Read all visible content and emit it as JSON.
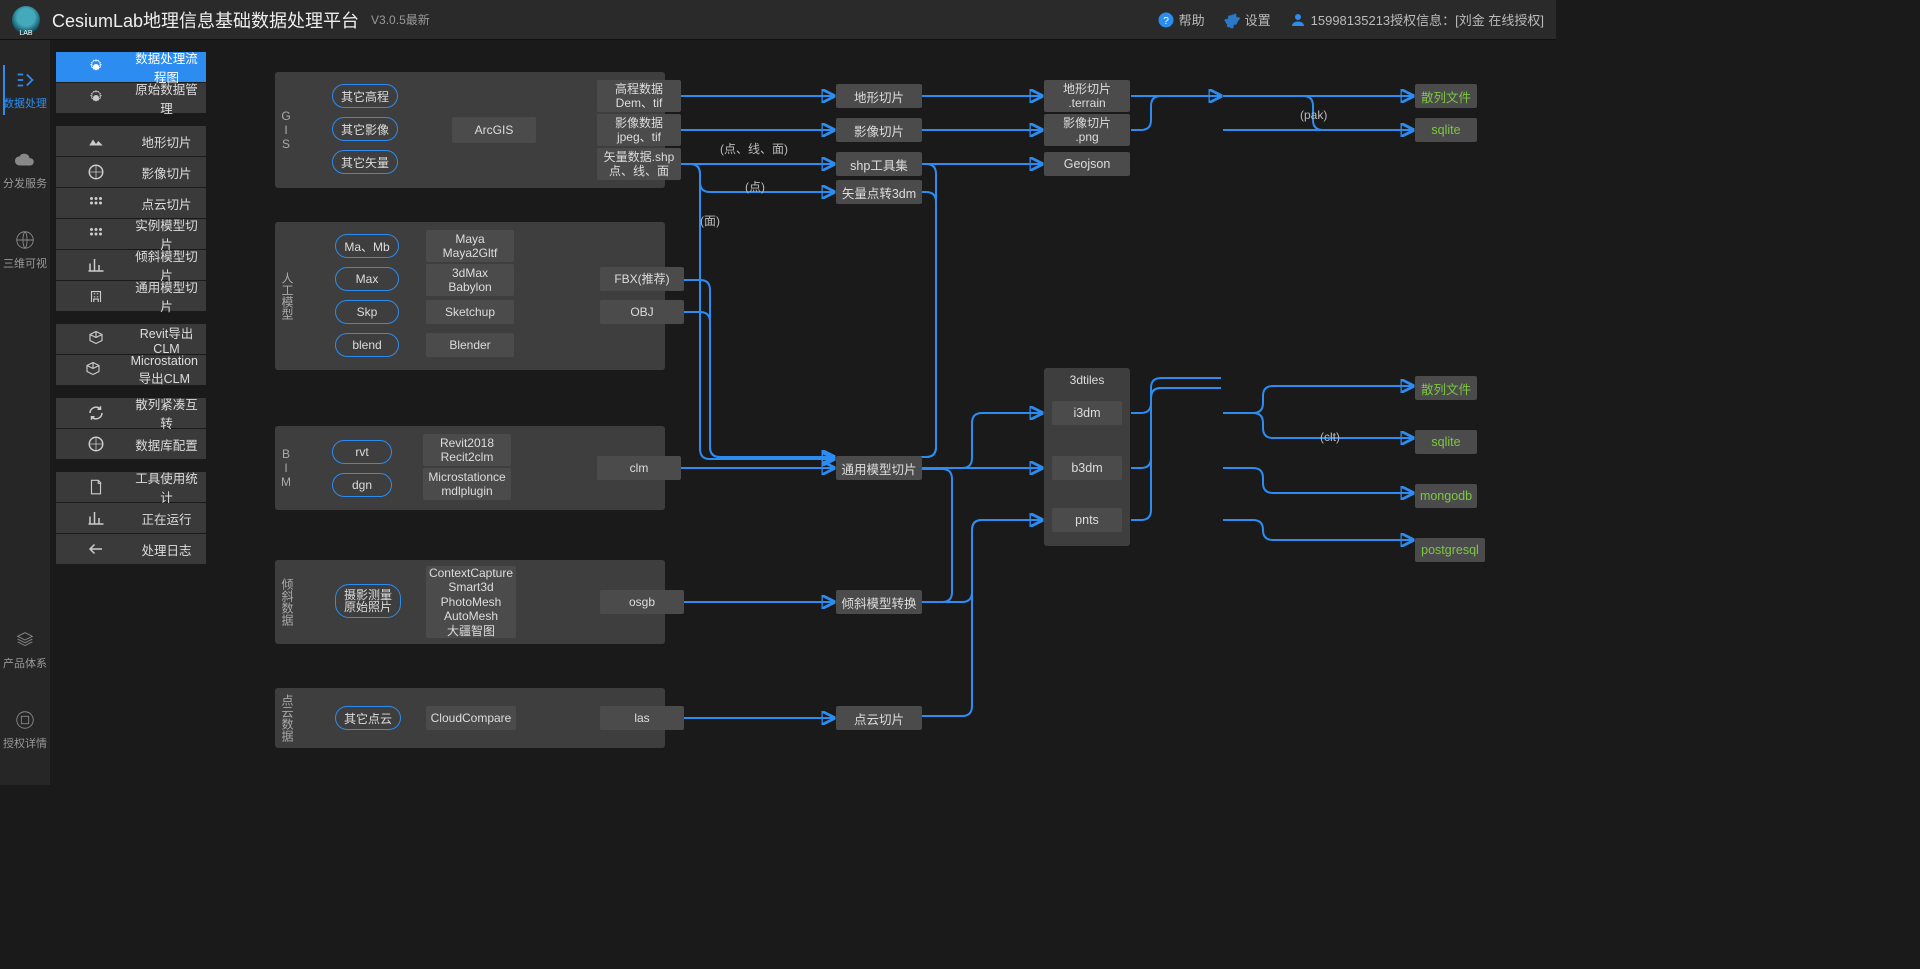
{
  "header": {
    "title": "CesiumLab地理信息基础数据处理平台",
    "version": "V3.0.5最新",
    "help": "帮助",
    "settings": "设置",
    "user": "15998135213授权信息：[刘金 在线授权]"
  },
  "leftnav": {
    "items": [
      {
        "label": "数据处理",
        "icon": "flow"
      },
      {
        "label": "分发服务",
        "icon": "cloud"
      },
      {
        "label": "三维可视",
        "icon": "globe"
      },
      {
        "label": "产品体系",
        "icon": "stack"
      },
      {
        "label": "授权详情",
        "icon": "key"
      }
    ]
  },
  "submenu": {
    "items": [
      {
        "label": "数据处理流程图",
        "icon": "gear",
        "active": true
      },
      {
        "label": "原始数据管理",
        "icon": "gear"
      },
      {
        "gap": true
      },
      {
        "label": "地形切片",
        "icon": "terrain"
      },
      {
        "label": "影像切片",
        "icon": "globe"
      },
      {
        "label": "点云切片",
        "icon": "grid"
      },
      {
        "label": "实例模型切片",
        "icon": "grid"
      },
      {
        "label": "倾斜模型切片",
        "icon": "chart"
      },
      {
        "label": "通用模型切片",
        "icon": "building"
      },
      {
        "gap": true
      },
      {
        "label": "Revit导出CLM",
        "icon": "cube"
      },
      {
        "label": "Microstation导出CLM",
        "icon": "cube"
      },
      {
        "gap": true
      },
      {
        "label": "散列紧凑互转",
        "icon": "refresh"
      },
      {
        "label": "数据库配置",
        "icon": "globe"
      },
      {
        "gap": true
      },
      {
        "label": "工具使用统计",
        "icon": "doc"
      },
      {
        "label": "正在运行",
        "icon": "chart"
      },
      {
        "label": "处理日志",
        "icon": "back"
      }
    ]
  },
  "flow": {
    "panels": {
      "gis": {
        "label": "GIS",
        "pills": [
          "其它高程",
          "其它影像",
          "其它矢量"
        ],
        "rects": [
          "ArcGIS",
          "高程数据\nDem、tif",
          "影像数据\njpeg、tif",
          "矢量数据.shp\n点、线、面"
        ]
      },
      "model": {
        "label": "人工模型",
        "pills": [
          "Ma、Mb",
          "Max",
          "Skp",
          "blend"
        ],
        "rects": [
          "Maya\nMaya2Gltf",
          "3dMax\nBabylon",
          "Sketchup",
          "Blender",
          "FBX(推荐)",
          "OBJ"
        ]
      },
      "bim": {
        "label": "BIM",
        "pills": [
          "rvt",
          "dgn"
        ],
        "rects": [
          "Revit2018\nRecit2clm",
          "Microstationce\nmdlplugin",
          "clm"
        ]
      },
      "tilt": {
        "label": "倾斜数据",
        "pills": [
          "摄影测量\n原始照片"
        ],
        "rects": [
          "ContextCapture\nSmart3d\nPhotoMesh\nAutoMesh\n大疆智图",
          "osgb"
        ]
      },
      "pc": {
        "label": "点云数据",
        "pills": [
          "其它点云"
        ],
        "rects": [
          "CloudCompare",
          "las"
        ]
      }
    },
    "mid": {
      "terrain": "地形切片",
      "image": "影像切片",
      "shptool": "shp工具集",
      "vec3dm": "矢量点转3dm",
      "generic": "通用模型切片",
      "tiltconv": "倾斜模型转换",
      "pcslice": "点云切片"
    },
    "labels": {
      "pxmm": "(点、线、面)",
      "dian": "(点)",
      "mian": "(面)",
      "pak": "(pak)",
      "clt": "(clt)"
    },
    "right": {
      "terrainSlice": "地形切片\n.terrain",
      "imageSlice": "影像切片\n.png",
      "geojson": "Geojson",
      "3dtiles": "3dtiles",
      "i3dm": "i3dm",
      "b3dm": "b3dm",
      "pnts": "pnts"
    },
    "outputs": {
      "sanlie": "散列文件",
      "sqlite": "sqlite",
      "mongodb": "mongodb",
      "postgresql": "postgresql"
    }
  }
}
